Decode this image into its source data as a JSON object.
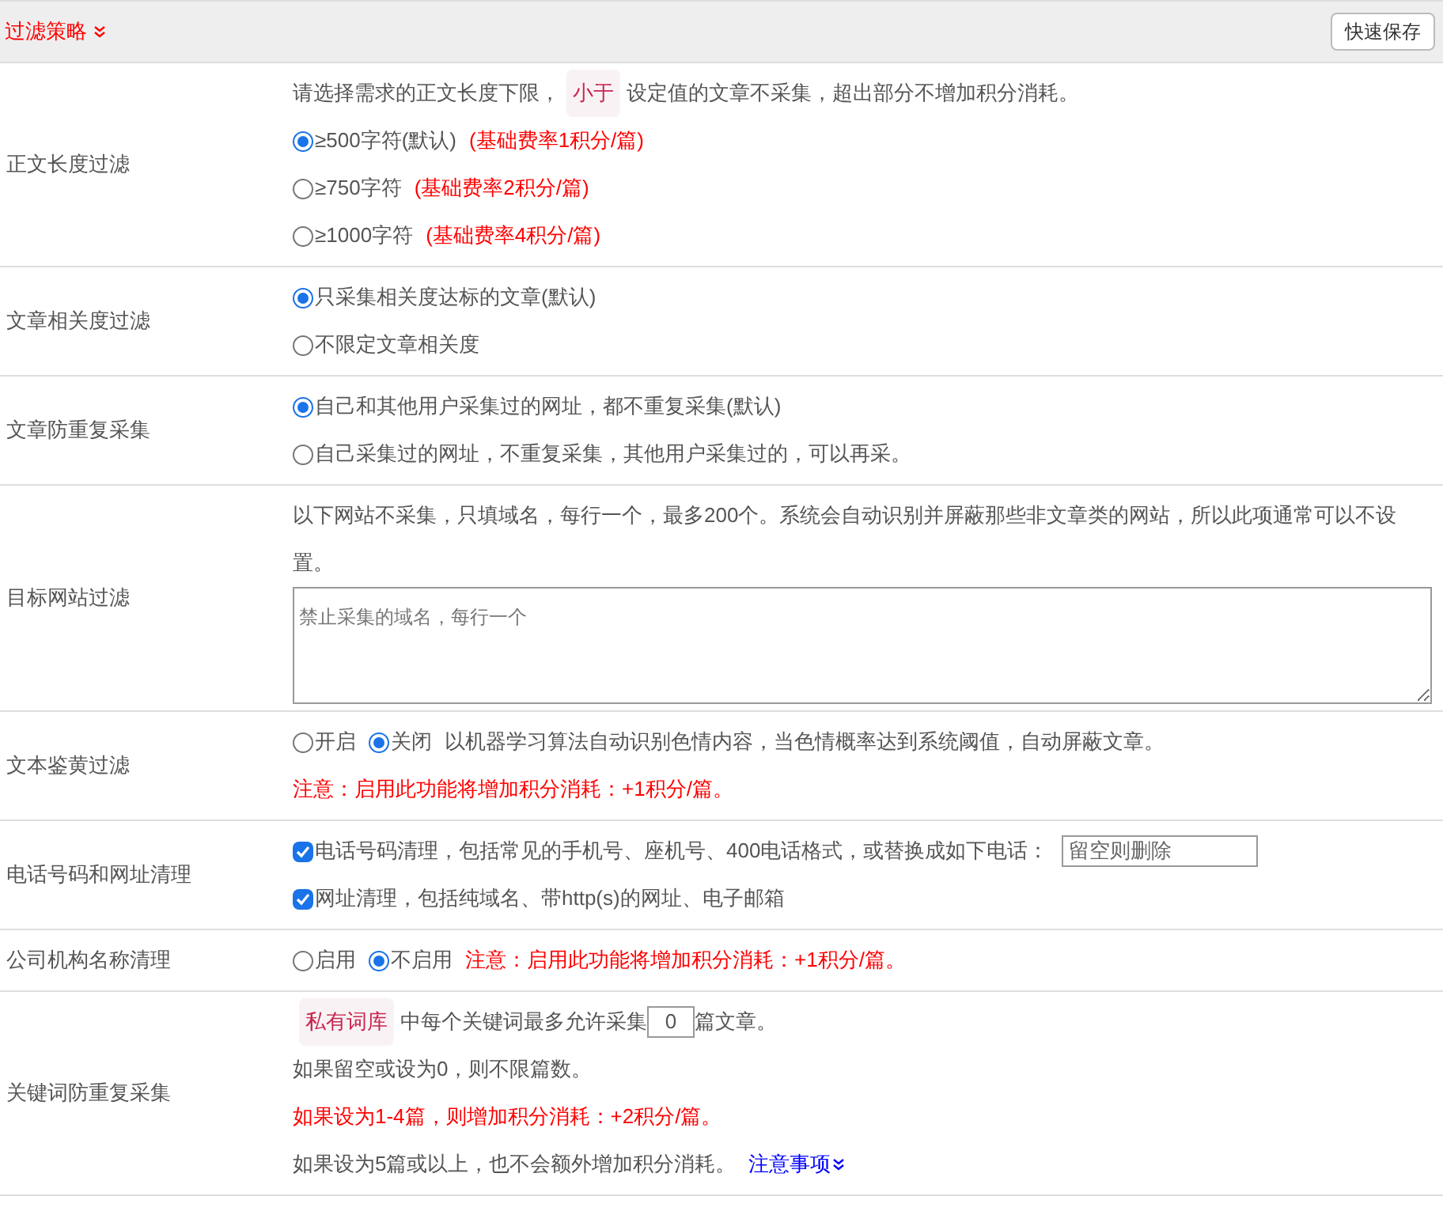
{
  "header": {
    "title": "过滤策略",
    "save_button": "快速保存"
  },
  "sections": [
    {
      "label": "正文长度过滤",
      "lines": [
        [
          {
            "kind": "plain",
            "text": "请选择需求的正文长度下限，"
          },
          {
            "kind": "tag",
            "text": "小于"
          },
          {
            "kind": "plain",
            "text": "设定值的文章不采集，超出部分不增加积分消耗。"
          }
        ],
        [
          {
            "kind": "radio",
            "text": "≥500字符(默认)",
            "selected": true
          },
          {
            "kind": "warn",
            "text": "(基础费率1积分/篇)"
          }
        ],
        [
          {
            "kind": "radio",
            "text": "≥750字符",
            "selected": false
          },
          {
            "kind": "warn",
            "text": "(基础费率2积分/篇)"
          }
        ],
        [
          {
            "kind": "radio",
            "text": "≥1000字符",
            "selected": false
          },
          {
            "kind": "warn",
            "text": "(基础费率4积分/篇)"
          }
        ]
      ]
    },
    {
      "label": "文章相关度过滤",
      "lines": [
        [
          {
            "kind": "radio",
            "text": "只采集相关度达标的文章(默认)",
            "selected": true
          }
        ],
        [
          {
            "kind": "radio",
            "text": "不限定文章相关度",
            "selected": false
          }
        ]
      ]
    },
    {
      "label": "文章防重复采集",
      "lines": [
        [
          {
            "kind": "radio",
            "text": "自己和其他用户采集过的网址，都不重复采集(默认)",
            "selected": true
          }
        ],
        [
          {
            "kind": "radio",
            "text": "自己采集过的网址，不重复采集，其他用户采集过的，可以再采。",
            "selected": false
          }
        ]
      ]
    },
    {
      "label": "目标网站过滤",
      "lines": [
        [
          {
            "kind": "plain",
            "text": "以下网站不采集，只填域名，每行一个，最多200个。系统会自动识别并屏蔽那些非文章类的网站，所以此项通常可以不设置。"
          }
        ],
        [
          {
            "kind": "textarea",
            "placeholder": "禁止采集的域名，每行一个"
          }
        ]
      ]
    },
    {
      "label": "文本鉴黄过滤",
      "lines": [
        [
          {
            "kind": "radio",
            "text": "开启",
            "selected": false
          },
          {
            "kind": "radio",
            "text": "关闭",
            "selected": true
          },
          {
            "kind": "plain",
            "text": "以机器学习算法自动识别色情内容，当色情概率达到系统阈值，自动屏蔽文章。"
          }
        ],
        [
          {
            "kind": "warn",
            "text": "注意：启用此功能将增加积分消耗：+1积分/篇。"
          }
        ]
      ]
    },
    {
      "label": "电话号码和网址清理",
      "lines": [
        [
          {
            "kind": "checkbox",
            "text": "电话号码清理，包括常见的手机号、座机号、400电话格式，或替换成如下电话：",
            "checked": true
          },
          {
            "kind": "input",
            "placeholder": "留空则删除"
          }
        ],
        [
          {
            "kind": "checkbox",
            "text": "网址清理，包括纯域名、带http(s)的网址、电子邮箱",
            "checked": true
          }
        ]
      ]
    },
    {
      "label": "公司机构名称清理",
      "lines": [
        [
          {
            "kind": "radio",
            "text": "启用",
            "selected": false
          },
          {
            "kind": "radio",
            "text": "不启用",
            "selected": true
          },
          {
            "kind": "warn",
            "text": "注意：启用此功能将增加积分消耗：+1积分/篇。"
          }
        ]
      ]
    },
    {
      "label": "关键词防重复采集",
      "lines": [
        [
          {
            "kind": "tag",
            "text": "私有词库"
          },
          {
            "kind": "plain",
            "text": "中每个关键词最多允许采集"
          },
          {
            "kind": "number",
            "value": "0"
          },
          {
            "kind": "plain",
            "text": "篇文章。"
          }
        ],
        [
          {
            "kind": "plain",
            "text": "如果留空或设为0，则不限篇数。"
          }
        ],
        [
          {
            "kind": "warn",
            "text": "如果设为1-4篇，则增加积分消耗：+2积分/篇。"
          }
        ],
        [
          {
            "kind": "plain",
            "text": "如果设为5篇或以上，也不会额外增加积分消耗。"
          },
          {
            "kind": "link",
            "text": "注意事项"
          }
        ]
      ]
    }
  ]
}
